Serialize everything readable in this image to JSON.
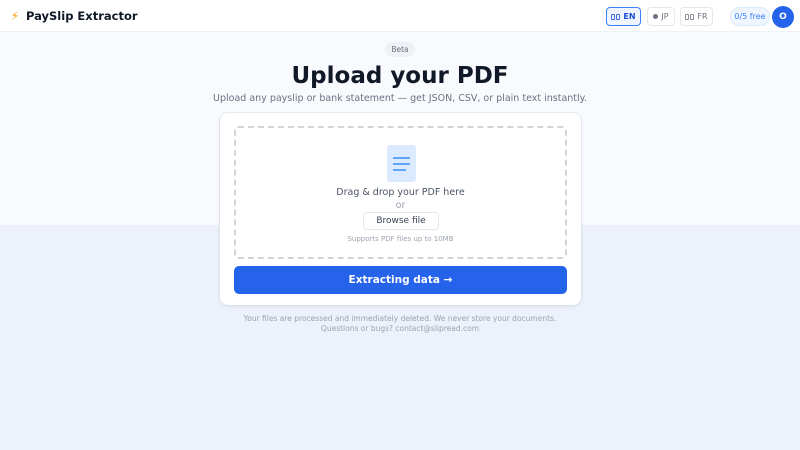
{
  "header": {
    "logo_icon": "⚡",
    "title": "PaySlip Extractor",
    "languages": [
      {
        "code": "EN",
        "active": true
      },
      {
        "code": "JP",
        "active": false
      },
      {
        "code": "FR",
        "active": false
      }
    ],
    "credits": "0/5 free",
    "avatar_initial": "O"
  },
  "hero": {
    "badge": "Beta",
    "title": "Upload your PDF",
    "subtitle": "Upload any payslip or bank statement — get JSON, CSV, or plain text instantly."
  },
  "upload": {
    "drop_text": "Drag & drop your PDF here",
    "or_text": "or",
    "browse_label": "Browse file",
    "supports_text": "Supports PDF files up to 10MB",
    "submit_label": "Extracting data →"
  },
  "footer": {
    "privacy": "Your files are processed and immediately deleted. We never store your documents.",
    "contact": "Questions or bugs?  contact@slipread.com"
  },
  "colors": {
    "accent": "#2563eb",
    "logo": "#f59e0b",
    "page_background": "#ecf1fb"
  },
  "icons": {
    "logo": "lightning-icon",
    "document": "document-icon",
    "language_en": "flag-icon",
    "language_jp": "dot-icon",
    "language_fr": "flag-icon"
  }
}
